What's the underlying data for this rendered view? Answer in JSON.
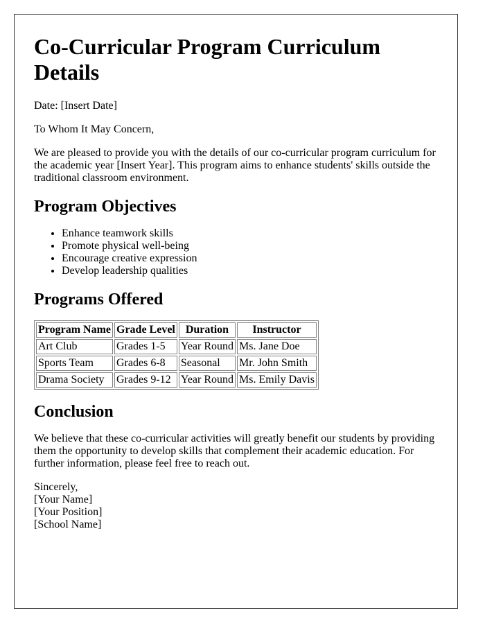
{
  "document": {
    "title": "Co-Curricular Program Curriculum Details",
    "date_line": "Date: [Insert Date]",
    "salutation": "To Whom It May Concern,",
    "intro": "We are pleased to provide you with the details of our co-curricular program curriculum for the academic year [Insert Year]. This program aims to enhance students' skills outside the traditional classroom environment.",
    "objectives": {
      "heading": "Program Objectives",
      "items": [
        "Enhance teamwork skills",
        "Promote physical well-being",
        "Encourage creative expression",
        "Develop leadership qualities"
      ]
    },
    "programs": {
      "heading": "Programs Offered",
      "columns": [
        "Program Name",
        "Grade Level",
        "Duration",
        "Instructor"
      ],
      "rows": [
        [
          "Art Club",
          "Grades 1-5",
          "Year Round",
          "Ms. Jane Doe"
        ],
        [
          "Sports Team",
          "Grades 6-8",
          "Seasonal",
          "Mr. John Smith"
        ],
        [
          "Drama Society",
          "Grades 9-12",
          "Year Round",
          "Ms. Emily Davis"
        ]
      ]
    },
    "conclusion": {
      "heading": "Conclusion",
      "text": "We believe that these co-curricular activities will greatly benefit our students by providing them the opportunity to develop skills that complement their academic education. For further information, please feel free to reach out."
    },
    "signature": {
      "closing": "Sincerely,",
      "name": "[Your Name]",
      "position": "[Your Position]",
      "school": "[School Name]"
    }
  }
}
